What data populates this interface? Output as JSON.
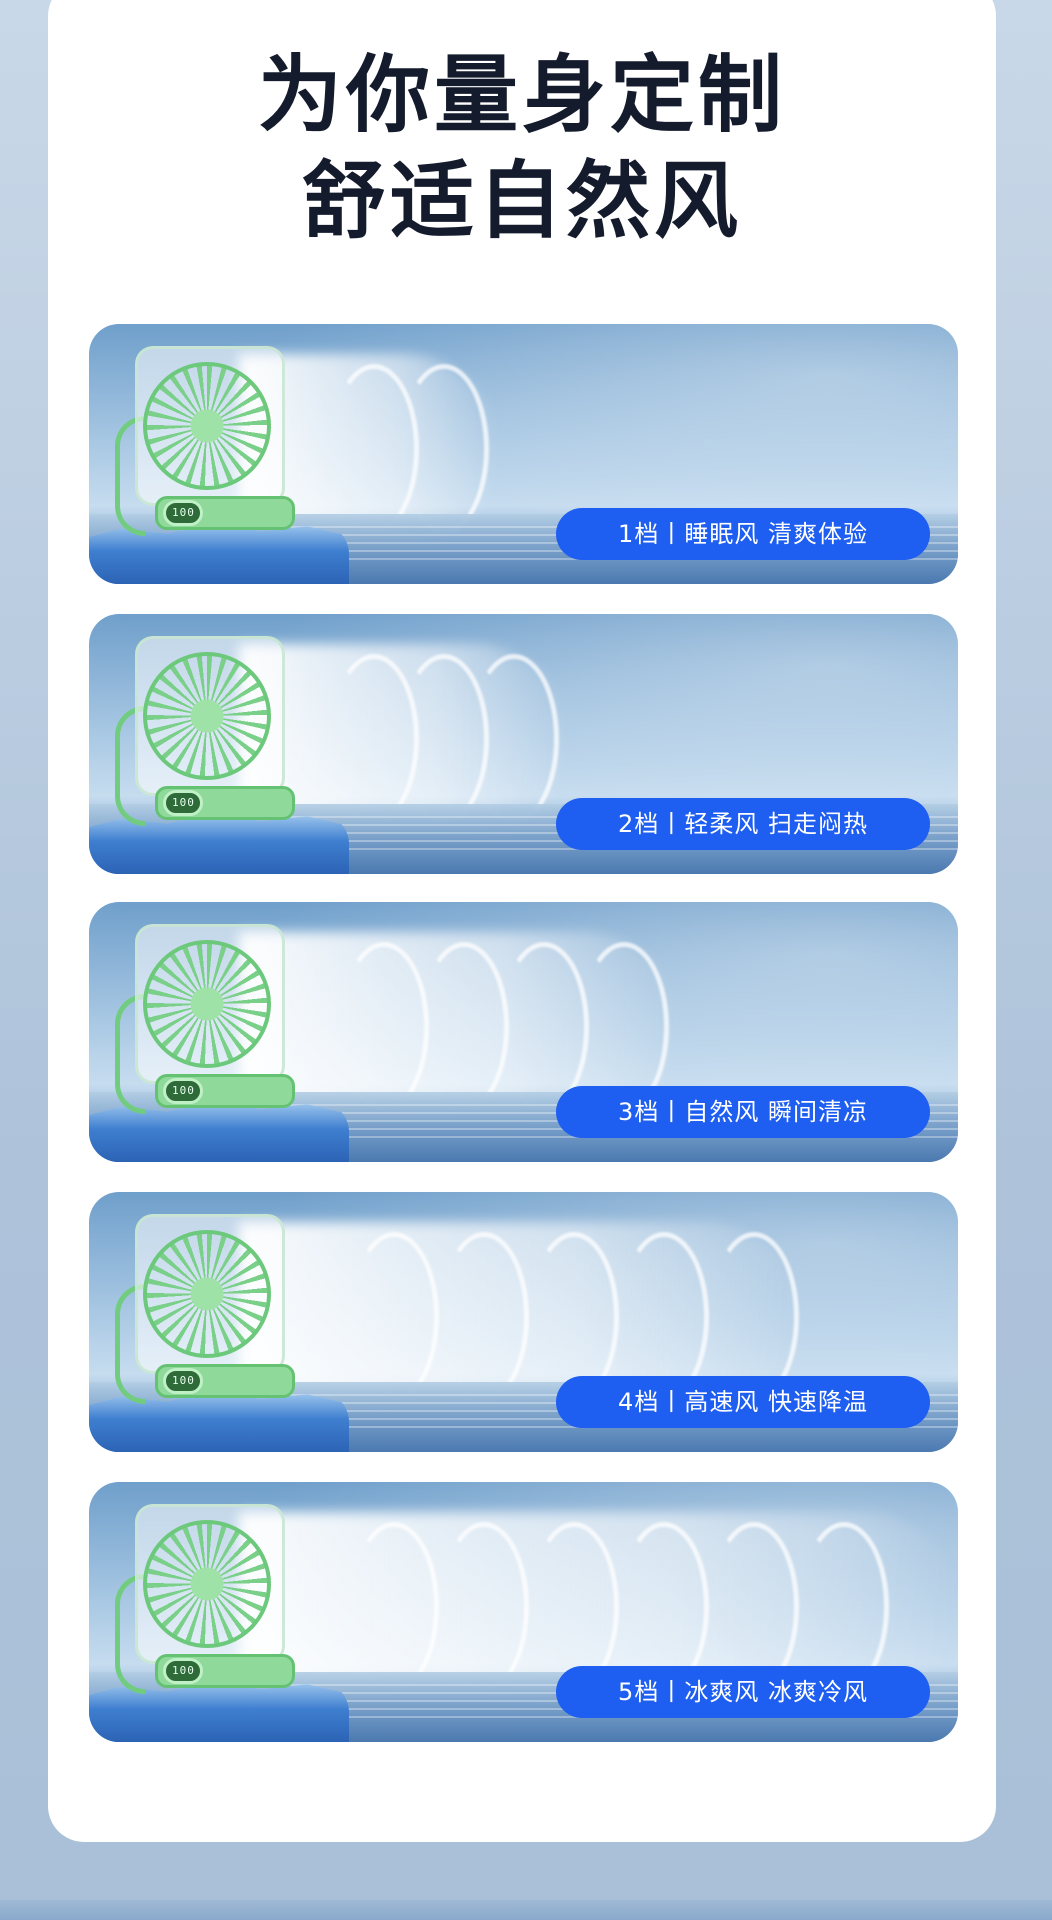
{
  "headline": {
    "line1": "为你量身定制",
    "line2": "舒适自然风"
  },
  "modes": [
    {
      "label": "1档丨睡眠风 清爽体验",
      "display": "100"
    },
    {
      "label": "2档丨轻柔风 扫走闷热",
      "display": "100"
    },
    {
      "label": "3档丨自然风 瞬间清凉",
      "display": "100"
    },
    {
      "label": "4档丨高速风 快速降温",
      "display": "100"
    },
    {
      "label": "5档丨冰爽风 冰爽冷风",
      "display": "100"
    }
  ],
  "colors": {
    "pill": "#1e5ef0",
    "headline": "#141b2c",
    "fan_green": "#72cc80"
  }
}
